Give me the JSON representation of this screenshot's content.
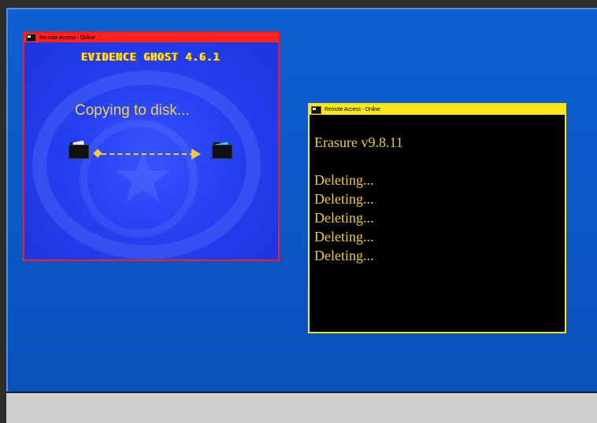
{
  "window1": {
    "title": "Remote Access - Online",
    "app_name": "EVIDENCE GHOST 4.6.1",
    "status": "Copying to disk..."
  },
  "window2": {
    "title": "Remote Access - Online",
    "header": "Erasure v9.8.11",
    "lines": [
      "Deleting...",
      "Deleting...",
      "Deleting...",
      "Deleting...",
      "Deleting..."
    ]
  },
  "colors": {
    "window1_border": "#ff1a1a",
    "window2_border": "#ffe11a",
    "desktop": "#0b57c6",
    "text_gold": "#f0c84a"
  }
}
